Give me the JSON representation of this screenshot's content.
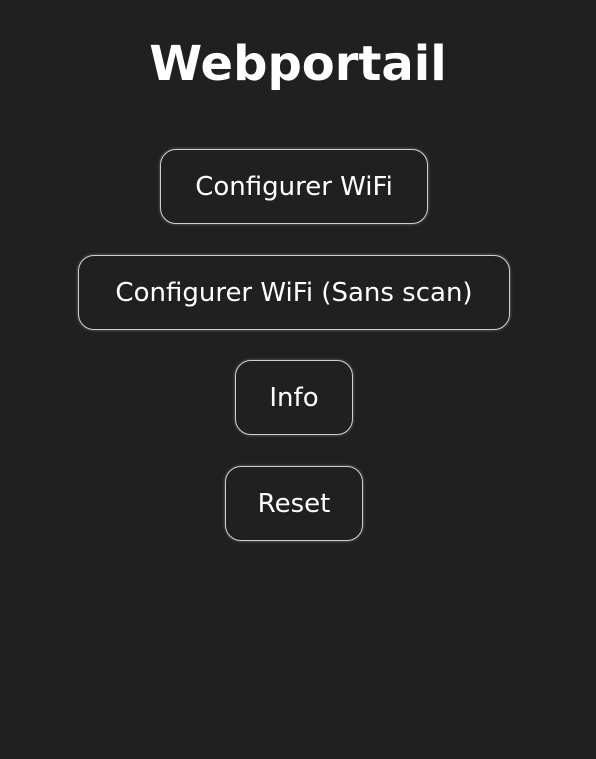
{
  "page": {
    "title": "Webportail"
  },
  "menu": {
    "configure_wifi_label": "Configurer WiFi",
    "configure_wifi_noscan_label": "Configurer WiFi (Sans scan)",
    "info_label": "Info",
    "reset_label": "Reset"
  },
  "colors": {
    "background": "#202020",
    "text": "#ffffff",
    "button_border": "#cfcfcf"
  }
}
